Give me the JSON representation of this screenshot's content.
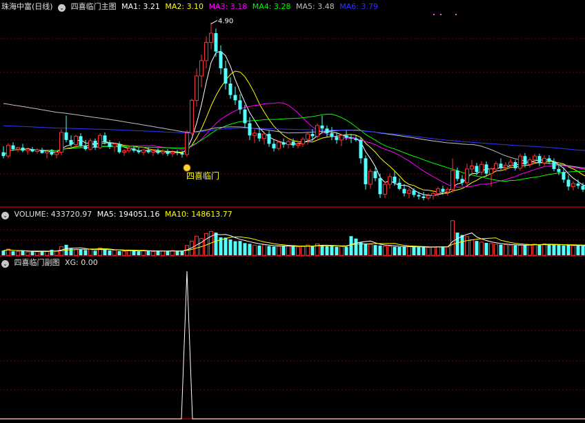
{
  "main_header": {
    "stock": "珠海中富(日线)",
    "indicator": "四喜临门主图",
    "ma": [
      {
        "label": "MA1:",
        "value": "3.21",
        "color": "#ffffff"
      },
      {
        "label": "MA2:",
        "value": "3.10",
        "color": "#ffff00"
      },
      {
        "label": "MA3:",
        "value": "3.18",
        "color": "#ff00ff"
      },
      {
        "label": "MA4:",
        "value": "3.28",
        "color": "#00ff00"
      },
      {
        "label": "MA5:",
        "value": "3.48",
        "color": "#c0c0c0"
      },
      {
        "label": "MA6:",
        "value": "3.79",
        "color": "#3333ff"
      }
    ]
  },
  "volume_header": {
    "label": "VOLUME:",
    "value": "433720.97",
    "ma5_label": "MA5:",
    "ma5_value": "194051.16",
    "ma10_label": "MA10:",
    "ma10_value": "148613.77"
  },
  "sub_header": {
    "indicator": "四喜临门副图",
    "xg_label": "XG:",
    "xg_value": "0.00"
  },
  "signal_label": "四喜临门",
  "peak_label": "4.90",
  "colors": {
    "up": "#ff3232",
    "down": "#54ffff",
    "grid": "#7a0000",
    "separator": "#b00000",
    "ma1": "#ffffff",
    "ma2": "#ffff00",
    "ma3": "#ff00ff",
    "ma4": "#00ff00",
    "ma5": "#c0c0c0",
    "ma6": "#3333ff",
    "vol_ma5": "#ffffff",
    "vol_ma10": "#ffff00",
    "xg_line": "#ffffff"
  },
  "chart_data": {
    "type": "candlestick",
    "price_range": [
      2.5,
      5.05
    ],
    "signal_index": 38,
    "peak_index": 43,
    "candles": [
      [
        3.2,
        3.28,
        3.12,
        3.15
      ],
      [
        3.15,
        3.32,
        3.12,
        3.29
      ],
      [
        3.29,
        3.33,
        3.22,
        3.24
      ],
      [
        3.24,
        3.27,
        3.2,
        3.26
      ],
      [
        3.26,
        3.31,
        3.2,
        3.22
      ],
      [
        3.22,
        3.26,
        3.17,
        3.24
      ],
      [
        3.24,
        3.27,
        3.2,
        3.21
      ],
      [
        3.21,
        3.25,
        3.18,
        3.23
      ],
      [
        3.23,
        3.26,
        3.18,
        3.19
      ],
      [
        3.19,
        3.23,
        3.12,
        3.21
      ],
      [
        3.21,
        3.24,
        3.15,
        3.17
      ],
      [
        3.17,
        3.22,
        3.12,
        3.2
      ],
      [
        3.2,
        3.5,
        3.16,
        3.46
      ],
      [
        3.46,
        3.68,
        3.33,
        3.36
      ],
      [
        3.36,
        3.42,
        3.27,
        3.3
      ],
      [
        3.3,
        3.43,
        3.26,
        3.41
      ],
      [
        3.41,
        3.45,
        3.27,
        3.29
      ],
      [
        3.29,
        3.36,
        3.22,
        3.24
      ],
      [
        3.24,
        3.38,
        3.22,
        3.35
      ],
      [
        3.35,
        3.38,
        3.23,
        3.26
      ],
      [
        3.26,
        3.45,
        3.24,
        3.42
      ],
      [
        3.42,
        3.46,
        3.3,
        3.33
      ],
      [
        3.33,
        3.36,
        3.24,
        3.27
      ],
      [
        3.27,
        3.33,
        3.2,
        3.31
      ],
      [
        3.31,
        3.34,
        3.18,
        3.2
      ],
      [
        3.2,
        3.24,
        3.15,
        3.22
      ],
      [
        3.22,
        3.28,
        3.19,
        3.25
      ],
      [
        3.25,
        3.28,
        3.2,
        3.22
      ],
      [
        3.22,
        3.26,
        3.18,
        3.2
      ],
      [
        3.2,
        3.25,
        3.16,
        3.23
      ],
      [
        3.23,
        3.26,
        3.18,
        3.2
      ],
      [
        3.2,
        3.24,
        3.15,
        3.22
      ],
      [
        3.22,
        3.25,
        3.17,
        3.19
      ],
      [
        3.19,
        3.24,
        3.16,
        3.21
      ],
      [
        3.21,
        3.24,
        3.15,
        3.18
      ],
      [
        3.18,
        3.23,
        3.14,
        3.2
      ],
      [
        3.2,
        3.23,
        3.16,
        3.19
      ],
      [
        3.19,
        3.22,
        3.13,
        3.17
      ],
      [
        3.17,
        3.49,
        3.14,
        3.45
      ],
      [
        3.45,
        3.9,
        3.42,
        3.88
      ],
      [
        3.88,
        4.3,
        3.8,
        4.2
      ],
      [
        4.2,
        4.48,
        4.05,
        4.4
      ],
      [
        4.4,
        4.72,
        4.3,
        4.64
      ],
      [
        4.64,
        4.9,
        4.55,
        4.76
      ],
      [
        4.76,
        4.82,
        4.45,
        4.52
      ],
      [
        4.52,
        4.6,
        4.22,
        4.3
      ],
      [
        4.3,
        4.4,
        4.02,
        4.1
      ],
      [
        4.1,
        4.18,
        3.9,
        3.95
      ],
      [
        3.95,
        4.06,
        3.82,
        3.88
      ],
      [
        3.88,
        3.96,
        3.7,
        3.76
      ],
      [
        3.76,
        3.82,
        3.52,
        3.58
      ],
      [
        3.58,
        3.66,
        3.36,
        3.42
      ],
      [
        3.42,
        3.5,
        3.32,
        3.45
      ],
      [
        3.45,
        3.52,
        3.34,
        3.38
      ],
      [
        3.38,
        3.47,
        3.3,
        3.44
      ],
      [
        3.44,
        3.48,
        3.27,
        3.31
      ],
      [
        3.31,
        3.36,
        3.21,
        3.25
      ],
      [
        3.25,
        3.35,
        3.22,
        3.33
      ],
      [
        3.33,
        3.38,
        3.26,
        3.3
      ],
      [
        3.3,
        3.36,
        3.25,
        3.34
      ],
      [
        3.34,
        3.38,
        3.26,
        3.29
      ],
      [
        3.29,
        3.34,
        3.25,
        3.31
      ],
      [
        3.31,
        3.4,
        3.27,
        3.37
      ],
      [
        3.37,
        3.47,
        3.3,
        3.44
      ],
      [
        3.44,
        3.5,
        3.35,
        3.41
      ],
      [
        3.41,
        3.58,
        3.38,
        3.55
      ],
      [
        3.55,
        3.68,
        3.46,
        3.51
      ],
      [
        3.51,
        3.55,
        3.4,
        3.45
      ],
      [
        3.45,
        3.53,
        3.36,
        3.4
      ],
      [
        3.4,
        3.46,
        3.31,
        3.36
      ],
      [
        3.36,
        3.44,
        3.28,
        3.42
      ],
      [
        3.42,
        3.48,
        3.36,
        3.39
      ],
      [
        3.39,
        3.44,
        3.32,
        3.38
      ],
      [
        3.38,
        3.42,
        3.34,
        3.36
      ],
      [
        3.36,
        3.4,
        3.05,
        3.12
      ],
      [
        3.12,
        3.16,
        2.71,
        2.78
      ],
      [
        2.78,
        2.98,
        2.72,
        2.95
      ],
      [
        2.95,
        3.0,
        2.82,
        2.86
      ],
      [
        2.86,
        2.92,
        2.6,
        2.65
      ],
      [
        2.65,
        2.81,
        2.6,
        2.78
      ],
      [
        2.78,
        2.92,
        2.72,
        2.88
      ],
      [
        2.88,
        2.95,
        2.76,
        2.8
      ],
      [
        2.8,
        2.86,
        2.7,
        2.72
      ],
      [
        2.72,
        2.78,
        2.62,
        2.66
      ],
      [
        2.66,
        2.74,
        2.6,
        2.7
      ],
      [
        2.7,
        2.73,
        2.61,
        2.64
      ],
      [
        2.64,
        2.68,
        2.58,
        2.62
      ],
      [
        2.62,
        2.68,
        2.57,
        2.6
      ],
      [
        2.6,
        2.66,
        2.57,
        2.63
      ],
      [
        2.63,
        2.7,
        2.58,
        2.66
      ],
      [
        2.66,
        2.75,
        2.62,
        2.72
      ],
      [
        2.72,
        2.76,
        2.64,
        2.68
      ],
      [
        2.68,
        2.74,
        2.63,
        2.71
      ],
      [
        2.71,
        3.12,
        2.67,
        2.96
      ],
      [
        2.96,
        3.0,
        2.82,
        2.85
      ],
      [
        2.85,
        2.9,
        2.76,
        2.8
      ],
      [
        2.8,
        3.05,
        2.77,
        2.98
      ],
      [
        2.98,
        3.1,
        2.9,
        3.02
      ],
      [
        3.02,
        3.06,
        2.9,
        2.94
      ],
      [
        2.94,
        3.08,
        2.9,
        3.04
      ],
      [
        3.04,
        3.08,
        2.88,
        2.92
      ],
      [
        2.92,
        3.0,
        2.75,
        2.98
      ],
      [
        2.98,
        3.08,
        2.94,
        3.05
      ],
      [
        3.05,
        3.12,
        2.97,
        3.0
      ],
      [
        3.0,
        3.07,
        2.95,
        3.03
      ],
      [
        3.03,
        3.11,
        2.99,
        3.07
      ],
      [
        3.07,
        3.1,
        2.96,
        2.99
      ],
      [
        2.99,
        3.18,
        2.96,
        3.15
      ],
      [
        3.15,
        3.19,
        3.0,
        3.04
      ],
      [
        3.04,
        3.13,
        3.0,
        3.1
      ],
      [
        3.1,
        3.18,
        3.05,
        3.15
      ],
      [
        3.15,
        3.18,
        3.02,
        3.06
      ],
      [
        3.06,
        3.16,
        3.02,
        3.12
      ],
      [
        3.12,
        3.16,
        3.05,
        3.08
      ],
      [
        3.08,
        3.12,
        2.95,
        2.98
      ],
      [
        2.98,
        3.04,
        2.9,
        2.94
      ],
      [
        2.94,
        2.99,
        2.8,
        2.84
      ],
      [
        2.84,
        2.9,
        2.7,
        2.75
      ],
      [
        2.75,
        2.82,
        2.7,
        2.79
      ],
      [
        2.79,
        2.84,
        2.72,
        2.76
      ],
      [
        2.76,
        2.8,
        2.68,
        2.71
      ],
      [
        2.71,
        2.8,
        2.69,
        2.78
      ],
      [
        2.78,
        2.83,
        2.72,
        2.75
      ]
    ],
    "volume": [
      40,
      52,
      34,
      30,
      38,
      28,
      33,
      30,
      36,
      32,
      46,
      38,
      72,
      88,
      56,
      50,
      48,
      44,
      52,
      38,
      62,
      46,
      40,
      44,
      36,
      34,
      42,
      38,
      33,
      40,
      36,
      32,
      38,
      34,
      36,
      40,
      34,
      38,
      82,
      118,
      160,
      140,
      182,
      200,
      190,
      150,
      148,
      132,
      118,
      120,
      102,
      96,
      85,
      82,
      88,
      78,
      74,
      76,
      80,
      78,
      76,
      70,
      74,
      86,
      80,
      96,
      84,
      76,
      80,
      72,
      74,
      70,
      160,
      140,
      108,
      96,
      92,
      86,
      82,
      78,
      76,
      72,
      70,
      74,
      72,
      70,
      68,
      70,
      66,
      70,
      72,
      74,
      70,
      290,
      190,
      170,
      156,
      130,
      120,
      110,
      104,
      98,
      92,
      90,
      88,
      86,
      84,
      84,
      86,
      90,
      94,
      92,
      96,
      90,
      88,
      86,
      82,
      84,
      80,
      82,
      78,
      80
    ],
    "xg": {
      "peak_index": 38,
      "peak_value": 1,
      "range": [
        0,
        1
      ]
    }
  }
}
